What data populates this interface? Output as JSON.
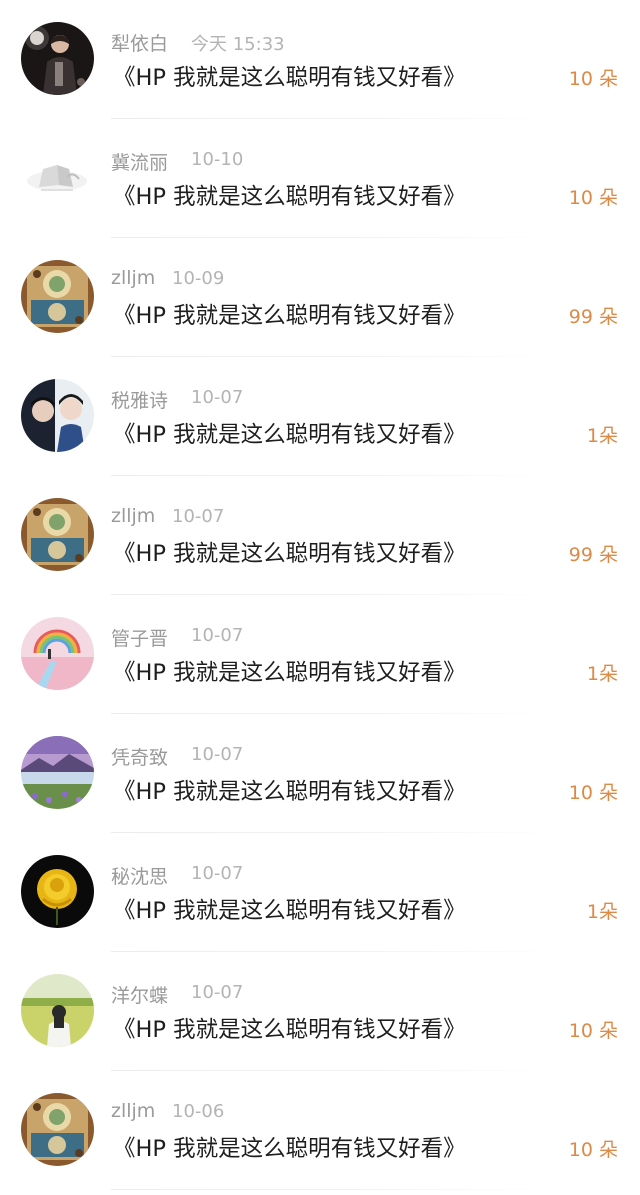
{
  "items": [
    {
      "name": "犁依白",
      "time": "今天 15:33",
      "title": "《HP 我就是这么聪明有钱又好看》",
      "count": "10 朵",
      "avatar": "performer-avatar-icon"
    },
    {
      "name": "冀流丽",
      "time": "10-10",
      "title": "《HP 我就是这么聪明有钱又好看》",
      "count": "10 朵",
      "avatar": "sketch-avatar-icon"
    },
    {
      "name": "zlljm",
      "time": "10-09",
      "title": "《HP 我就是这么聪明有钱又好看》",
      "count": "99 朵",
      "avatar": "ornate-art-avatar-icon"
    },
    {
      "name": "税雅诗",
      "time": "10-07",
      "title": "《HP 我就是这么聪明有钱又好看》",
      "count": "1朵",
      "avatar": "couple-avatar-icon"
    },
    {
      "name": "zlljm",
      "time": "10-07",
      "title": "《HP 我就是这么聪明有钱又好看》",
      "count": "99 朵",
      "avatar": "ornate-art-avatar-icon"
    },
    {
      "name": "管子晋",
      "time": "10-07",
      "title": "《HP 我就是这么聪明有钱又好看》",
      "count": "1朵",
      "avatar": "rainbow-avatar-icon"
    },
    {
      "name": "凭奇致",
      "time": "10-07",
      "title": "《HP 我就是这么聪明有钱又好看》",
      "count": "10 朵",
      "avatar": "lake-landscape-avatar-icon"
    },
    {
      "name": "秘沈思",
      "time": "10-07",
      "title": "《HP 我就是这么聪明有钱又好看》",
      "count": "1朵",
      "avatar": "yellow-rose-avatar-icon"
    },
    {
      "name": "洋尔蝶",
      "time": "10-07",
      "title": "《HP 我就是这么聪明有钱又好看》",
      "count": "10 朵",
      "avatar": "girl-in-field-avatar-icon"
    },
    {
      "name": "zlljm",
      "time": "10-06",
      "title": "《HP 我就是这么聪明有钱又好看》",
      "count": "10 朵",
      "avatar": "ornate-art-avatar-icon"
    }
  ],
  "colors": {
    "name": "#9a9a9a",
    "time": "#b4b4b4",
    "title": "#1e1e1e",
    "count": "#dd8a47",
    "divider": "#ececec"
  }
}
